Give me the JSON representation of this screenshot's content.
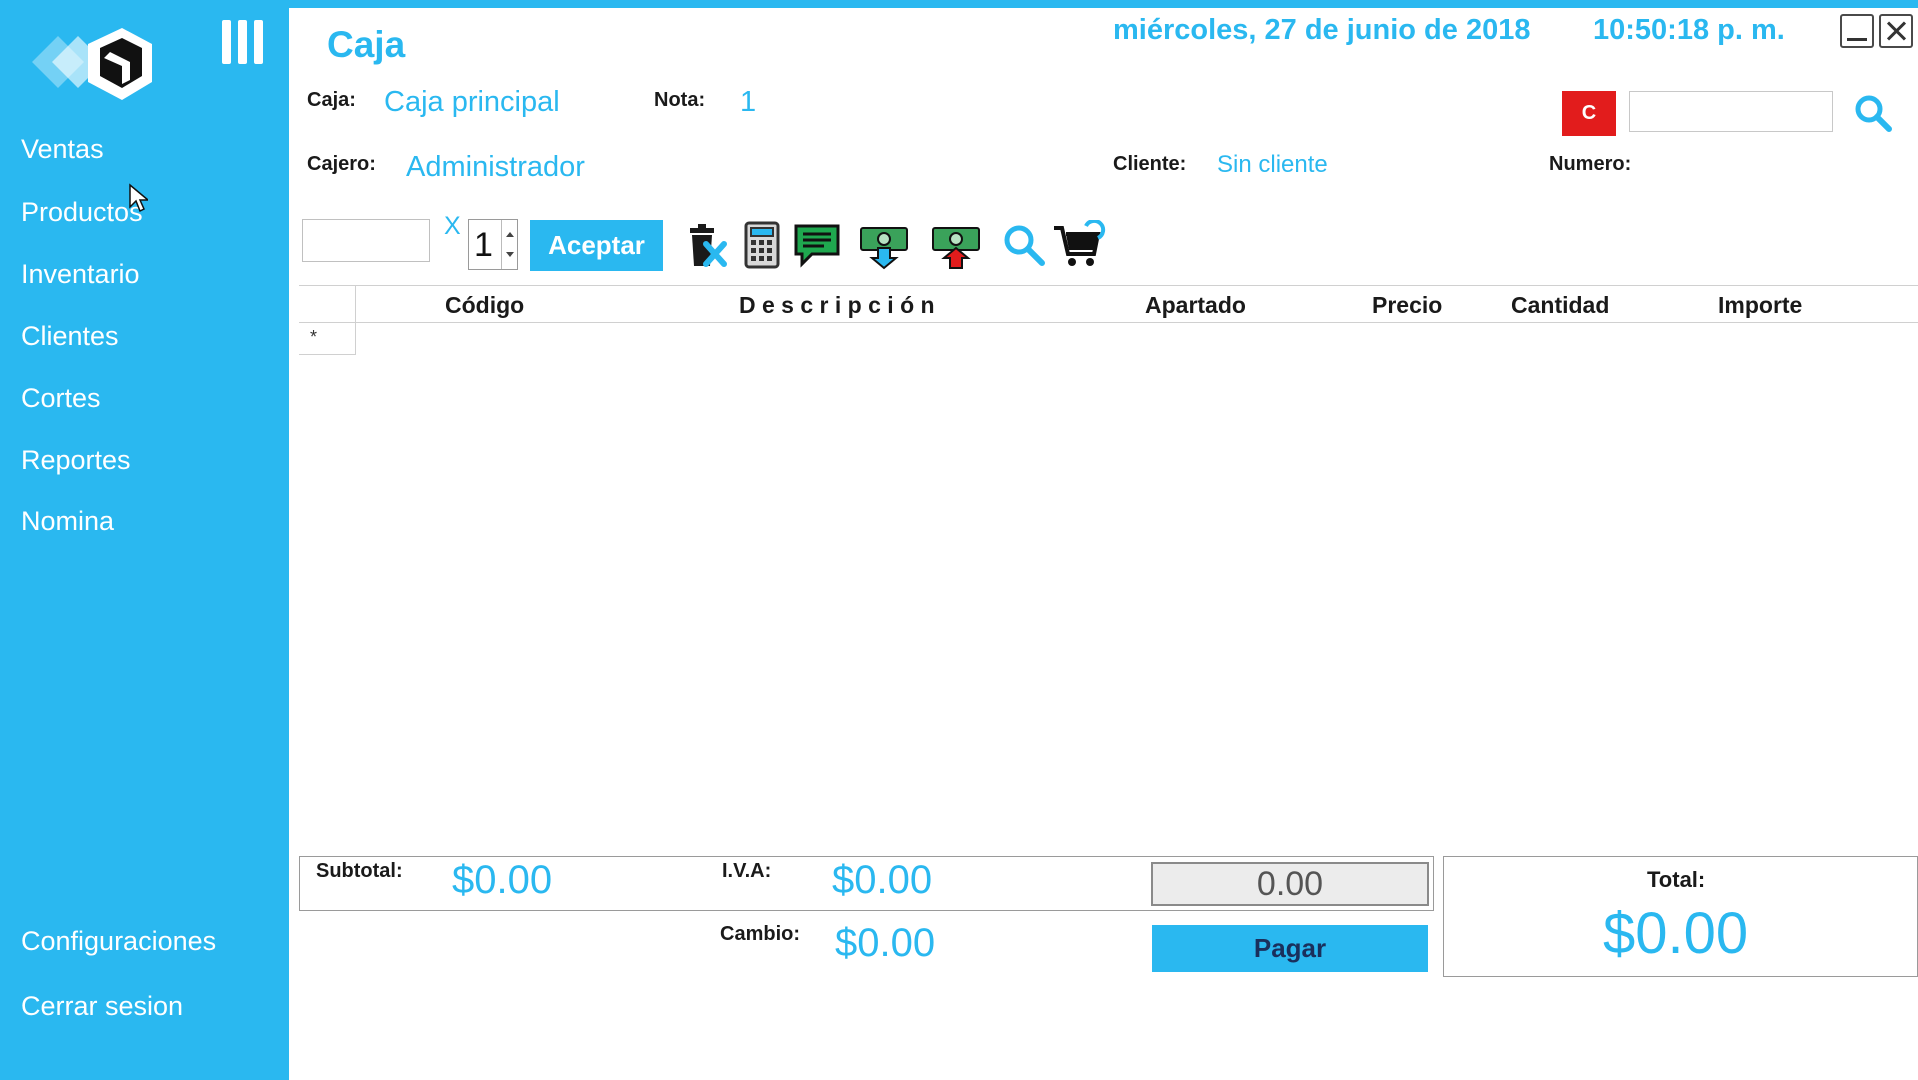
{
  "colors": {
    "accent": "#2ab8f0",
    "danger": "#e21c1c"
  },
  "sidebar": {
    "items": [
      {
        "label": "Ventas"
      },
      {
        "label": "Productos"
      },
      {
        "label": "Inventario"
      },
      {
        "label": "Clientes"
      },
      {
        "label": "Cortes"
      },
      {
        "label": "Reportes"
      },
      {
        "label": "Nomina"
      }
    ],
    "bottom_items": [
      {
        "label": "Configuraciones"
      },
      {
        "label": "Cerrar sesion"
      }
    ]
  },
  "header": {
    "title": "Caja",
    "date": "miércoles, 27 de junio de 2018",
    "time": "10:50:18 p. m."
  },
  "info": {
    "caja_label": "Caja:",
    "caja_value": "Caja principal",
    "nota_label": "Nota:",
    "nota_value": "1",
    "cajero_label": "Cajero:",
    "cajero_value": "Administrador",
    "cliente_label": "Cliente:",
    "cliente_value": "Sin cliente",
    "numero_label": "Numero:",
    "c_button": "C",
    "search_value": ""
  },
  "entry": {
    "code_value": "",
    "multiplier": "X",
    "quantity": "1",
    "accept_label": "Aceptar"
  },
  "toolbar": [
    "delete-item-icon",
    "calculator-icon",
    "comment-icon",
    "cash-in-icon",
    "cash-out-icon",
    "search-icon",
    "cart-icon"
  ],
  "grid": {
    "columns": [
      "Código",
      "D e s c r i p c i ó n",
      "Apartado",
      "Precio",
      "Cantidad",
      "Importe"
    ],
    "new_row_marker": "*"
  },
  "totals": {
    "subtotal_label": "Subtotal:",
    "subtotal_value": "$0.00",
    "iva_label": "I.V.A:",
    "iva_value": "$0.00",
    "cambio_label": "Cambio:",
    "cambio_value": "$0.00",
    "amount_value": "0.00",
    "pay_label": "Pagar",
    "total_label": "Total:",
    "total_value": "$0.00"
  }
}
